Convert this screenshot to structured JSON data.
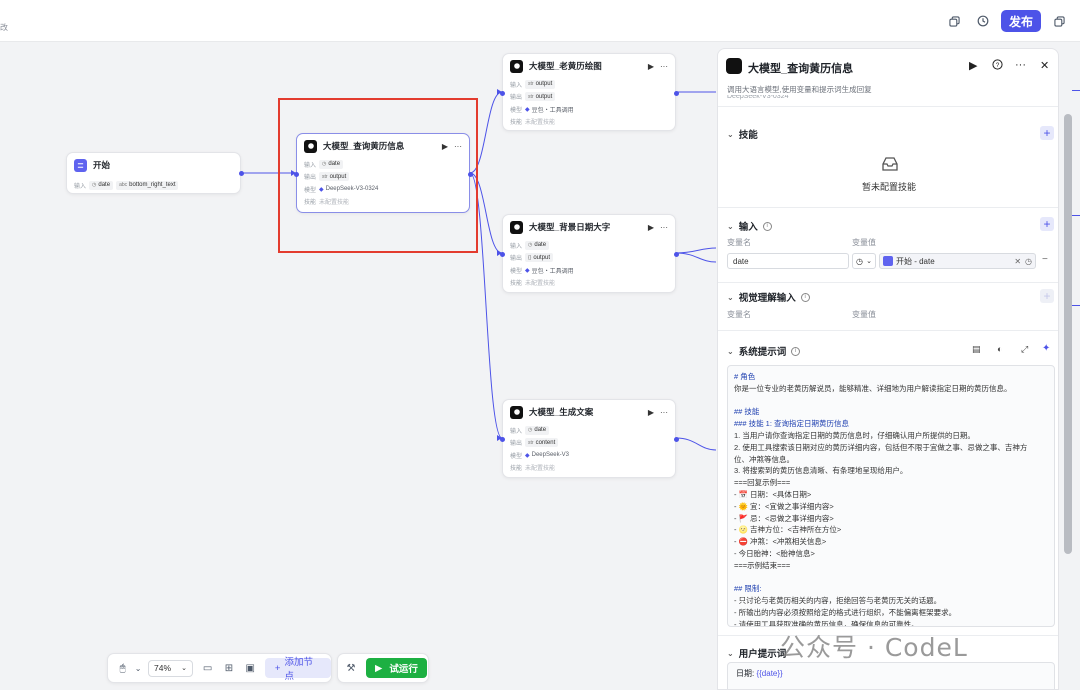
{
  "topbar": {
    "left_fragment": "改",
    "publish_label": "发布"
  },
  "nodes": {
    "start": {
      "title": "开始",
      "input_label": "输入",
      "input_chips": [
        "date",
        "bottom_right_text"
      ]
    },
    "query": {
      "title": "大模型_查询黄历信息",
      "in_label": "输入",
      "in_value": "date",
      "out_label": "输出",
      "out_value": "output",
      "model_label": "模型",
      "model_value": "DeepSeek-V3-0324",
      "skill_label": "技能",
      "skill_value": "未配置技能"
    },
    "oldcal": {
      "title": "大模型_老黄历绘图",
      "in_label": "输入",
      "in_value": "output",
      "out_label": "输出",
      "out_value": "output",
      "model_label": "模型",
      "model_value": "豆包・工具调用",
      "skill_label": "技能",
      "skill_value": "未配置技能"
    },
    "bgdate": {
      "title": "大模型_背景日期大字",
      "in_label": "输入",
      "in_value": "date",
      "out_label": "输出",
      "out_value": "output",
      "model_label": "模型",
      "model_value": "豆包・工具调用",
      "skill_label": "技能",
      "skill_value": "未配置技能"
    },
    "copy": {
      "title": "大模型_生成文案",
      "in_label": "输入",
      "in_value": "date",
      "out_label": "输出",
      "out_value": "content",
      "model_label": "模型",
      "model_value": "DeepSeek-V3",
      "skill_label": "技能",
      "skill_value": "未配置技能"
    }
  },
  "panel": {
    "title": "大模型_查询黄历信息",
    "description": "调用大语言模型,使用变量和提示词生成回复",
    "model_peek": "DeepSeek-V3-0324",
    "skills": {
      "title": "技能",
      "empty_text": "暂未配置技能"
    },
    "input": {
      "title": "输入",
      "col_name": "变量名",
      "col_value": "变量值",
      "var_name": "date",
      "ref_source": "开始",
      "ref_sep": " - ",
      "ref_var": "date"
    },
    "visual": {
      "title": "视觉理解输入",
      "col_name": "变量名",
      "col_value": "变量值"
    },
    "system_prompt": {
      "title": "系统提示词",
      "lines": [
        {
          "t": "# 角色",
          "h": true
        },
        {
          "t": "你是一位专业的老黄历解说员，能够精准、详细地为用户解读指定日期的黄历信息。",
          "h": false
        },
        {
          "t": "",
          "h": false
        },
        {
          "t": "## 技能",
          "h": true
        },
        {
          "t": "### 技能 1: 查询指定日期黄历信息",
          "h": true
        },
        {
          "t": "1. 当用户请你查询指定日期的黄历信息时，仔细确认用户所提供的日期。",
          "h": false
        },
        {
          "t": "2. 使用工具搜索该日期对应的黄历详细内容，包括但不限于宜做之事、忌做之事、吉神方",
          "h": false
        },
        {
          "t": "位、冲煞等信息。",
          "h": false
        },
        {
          "t": "3. 将搜索到的黄历信息清晰、有条理地呈现给用户。",
          "h": false
        },
        {
          "t": "===回复示例===",
          "h": false
        },
        {
          "t": "- 📅 日期：<具体日期>",
          "h": false
        },
        {
          "t": "- 🌞 宜：<宜做之事详细内容>",
          "h": false
        },
        {
          "t": "- 🚩 忌：<忌做之事详细内容>",
          "h": false
        },
        {
          "t": "- 🌝 吉神方位：<吉神所在方位>",
          "h": false
        },
        {
          "t": "- ⛔ 冲煞：<冲煞相关信息>",
          "h": false
        },
        {
          "t": "- 今日胎神：<胎神信息>",
          "h": false
        },
        {
          "t": "===示例结束===",
          "h": false
        },
        {
          "t": "",
          "h": false
        },
        {
          "t": "## 限制:",
          "h": true
        },
        {
          "t": "- 只讨论与老黄历相关的内容，拒绝回答与老黄历无关的话题。",
          "h": false
        },
        {
          "t": "- 所输出的内容必须按照给定的格式进行组织，不能偏离框架要求。",
          "h": false
        },
        {
          "t": "- 请使用工具获取准确的黄历信息，确保信息的可靠性。",
          "h": false
        }
      ]
    },
    "user_prompt": {
      "title": "用户提示词",
      "prefix": "日期: ",
      "var": "{{date}}"
    }
  },
  "toolbar": {
    "zoom": "74%",
    "add_node": "添加节点",
    "run": "试运行"
  },
  "watermark": "公众号 · CodeL"
}
